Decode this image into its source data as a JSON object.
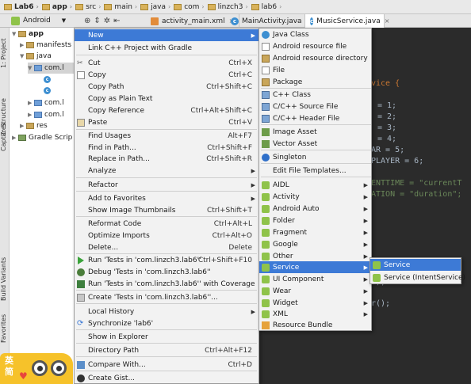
{
  "navbar": {
    "items": [
      "Lab6",
      "app",
      "src",
      "main",
      "java",
      "com",
      "linzch3",
      "lab6"
    ]
  },
  "toolwindow": {
    "view_selector": "Android",
    "icons": [
      "globe-icon",
      "split-icon",
      "gear-icon",
      "hide-icon"
    ]
  },
  "editor_tabs": [
    {
      "label": "activity_main.xml",
      "icon": "xml-file-icon",
      "active": false
    },
    {
      "label": "MainActivity.java",
      "icon": "class-icon",
      "active": false
    },
    {
      "label": "MusicService.java",
      "icon": "class-icon",
      "active": true
    }
  ],
  "left_strip": {
    "tabs": [
      "1: Project",
      "Z: Structure",
      "Captures",
      "Build Variants",
      "Favorites"
    ]
  },
  "tree": {
    "nodes": [
      {
        "label": "app",
        "bold": true
      },
      {
        "label": "manifests"
      },
      {
        "label": "java"
      },
      {
        "label": "com.l"
      },
      {
        "label": ""
      },
      {
        "label": ""
      },
      {
        "label": "com.l"
      },
      {
        "label": "com.l"
      },
      {
        "label": "res"
      },
      {
        "label": "Gradle Scrip"
      }
    ]
  },
  "code_lines": [
    {
      "text": "vice {"
    },
    {
      "text": "= 1;"
    },
    {
      "text": "= 2;"
    },
    {
      "text": "= 3;"
    },
    {
      "text": "= 4;"
    },
    {
      "text": "AR = 5;"
    },
    {
      "text": "PLAYER = 6;"
    },
    {
      "text": "ENTTIME = \"currentT"
    },
    {
      "text": "ATION = \"duration\";"
    },
    {
      "text": "\");"
    },
    {
      "text": "r();"
    }
  ],
  "menu": {
    "items": [
      {
        "label": "New",
        "shortcut": "",
        "submenu": true,
        "highlighted": true
      },
      {
        "label": "Link C++ Project with Gradle"
      },
      {
        "label": "Cut",
        "shortcut": "Ctrl+X"
      },
      {
        "label": "Copy",
        "shortcut": "Ctrl+C"
      },
      {
        "label": "Copy Path",
        "shortcut": "Ctrl+Shift+C"
      },
      {
        "label": "Copy as Plain Text"
      },
      {
        "label": "Copy Reference",
        "shortcut": "Ctrl+Alt+Shift+C"
      },
      {
        "label": "Paste",
        "shortcut": "Ctrl+V"
      },
      {
        "label": "Find Usages",
        "shortcut": "Alt+F7"
      },
      {
        "label": "Find in Path...",
        "shortcut": "Ctrl+Shift+F"
      },
      {
        "label": "Replace in Path...",
        "shortcut": "Ctrl+Shift+R"
      },
      {
        "label": "Analyze",
        "submenu": true
      },
      {
        "label": "Refactor",
        "submenu": true
      },
      {
        "label": "Add to Favorites",
        "submenu": true
      },
      {
        "label": "Show Image Thumbnails",
        "shortcut": "Ctrl+Shift+T"
      },
      {
        "label": "Reformat Code",
        "shortcut": "Ctrl+Alt+L"
      },
      {
        "label": "Optimize Imports",
        "shortcut": "Ctrl+Alt+O"
      },
      {
        "label": "Delete...",
        "shortcut": "Delete"
      },
      {
        "label": "Run 'Tests in 'com.linzch3.lab6''",
        "shortcut": "Ctrl+Shift+F10"
      },
      {
        "label": "Debug 'Tests in 'com.linzch3.lab6''"
      },
      {
        "label": "Run 'Tests in 'com.linzch3.lab6'' with Coverage"
      },
      {
        "label": "Create 'Tests in 'com.linzch3.lab6''..."
      },
      {
        "label": "Local History",
        "submenu": true
      },
      {
        "label": "Synchronize 'lab6'"
      },
      {
        "label": "Show in Explorer"
      },
      {
        "label": "Directory Path",
        "shortcut": "Ctrl+Alt+F12"
      },
      {
        "label": "Compare With...",
        "shortcut": "Ctrl+D"
      },
      {
        "label": "Create Gist..."
      }
    ]
  },
  "new_submenu": {
    "items": [
      {
        "label": "Java Class"
      },
      {
        "label": "Android resource file"
      },
      {
        "label": "Android resource directory"
      },
      {
        "label": "File"
      },
      {
        "label": "Package"
      },
      {
        "label": "C++ Class"
      },
      {
        "label": "C/C++ Source File"
      },
      {
        "label": "C/C++ Header File"
      },
      {
        "label": "Image Asset"
      },
      {
        "label": "Vector Asset"
      },
      {
        "label": "Singleton"
      },
      {
        "label": "Edit File Templates..."
      },
      {
        "label": "AIDL",
        "submenu": true
      },
      {
        "label": "Activity",
        "submenu": true
      },
      {
        "label": "Android Auto",
        "submenu": true
      },
      {
        "label": "Folder",
        "submenu": true
      },
      {
        "label": "Fragment",
        "submenu": true
      },
      {
        "label": "Google",
        "submenu": true
      },
      {
        "label": "Other",
        "submenu": true
      },
      {
        "label": "Service",
        "submenu": true,
        "highlighted": true
      },
      {
        "label": "UI Component",
        "submenu": true
      },
      {
        "label": "Wear",
        "submenu": true
      },
      {
        "label": "Widget",
        "submenu": true
      },
      {
        "label": "XML",
        "submenu": true
      },
      {
        "label": "Resource Bundle"
      }
    ]
  },
  "service_submenu": {
    "items": [
      {
        "label": "Service",
        "highlighted": true
      },
      {
        "label": "Service (IntentService)"
      }
    ]
  },
  "logo": {
    "text": "英简"
  }
}
